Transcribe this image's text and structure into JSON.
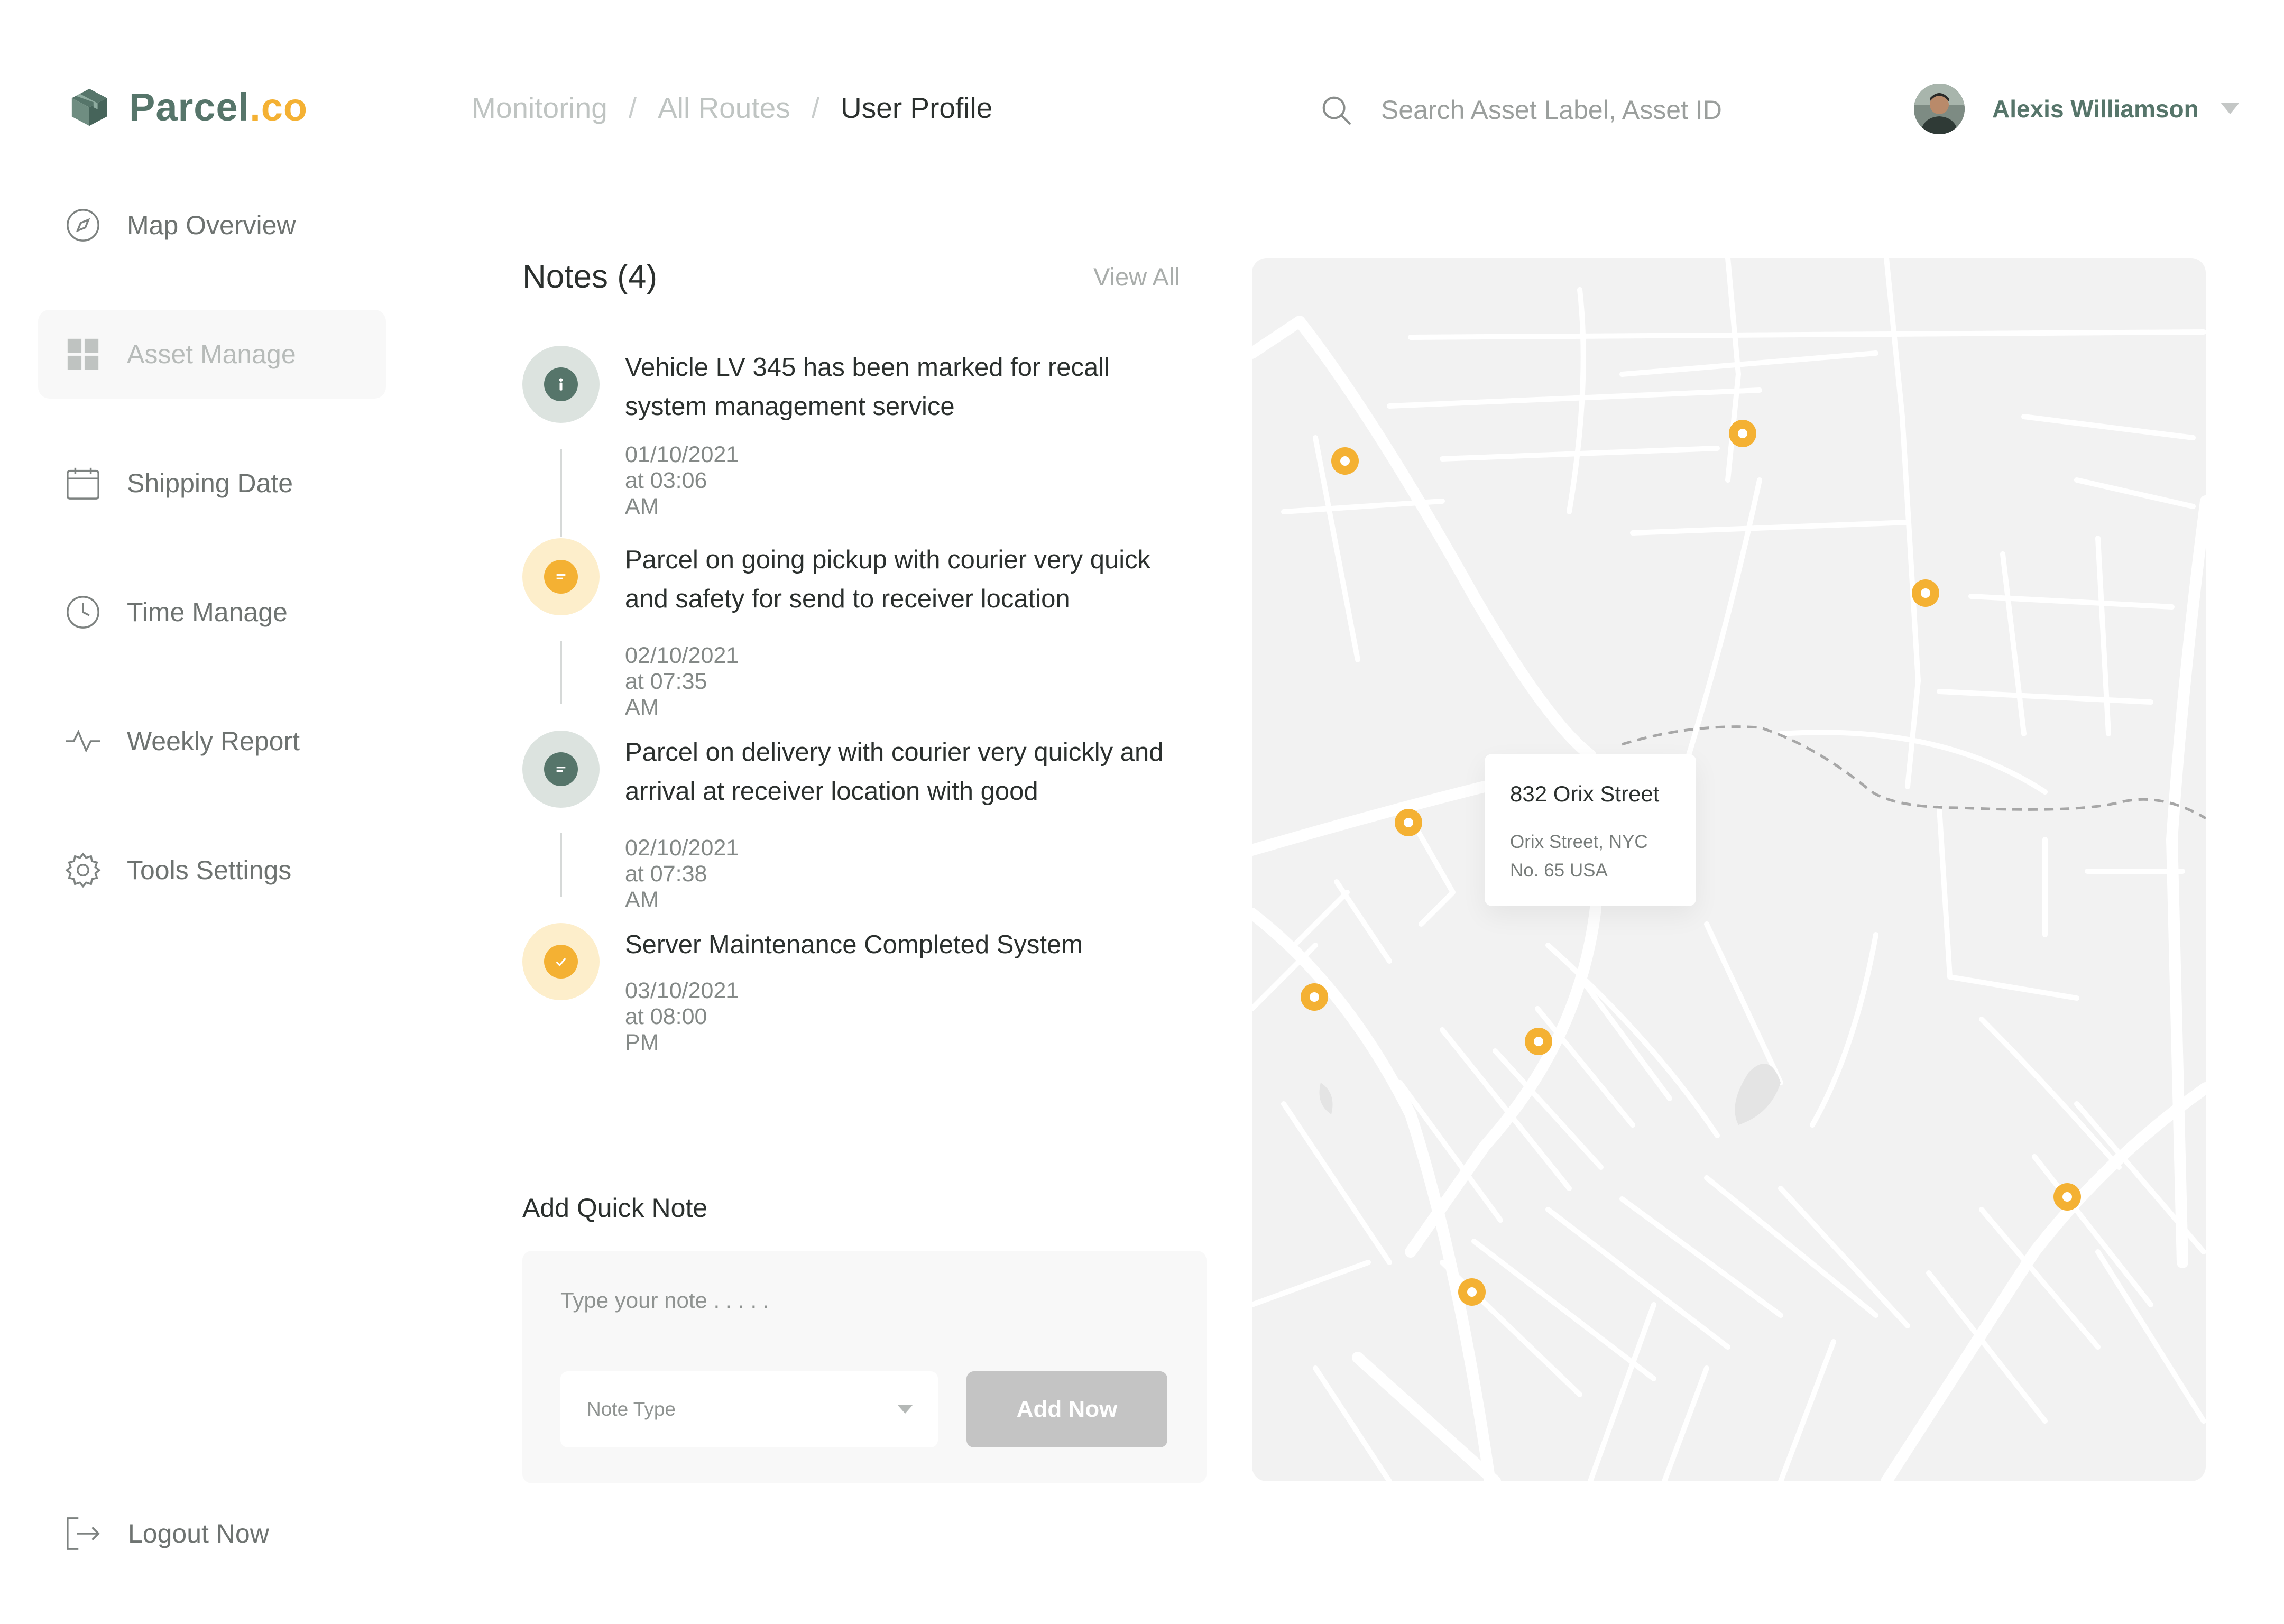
{
  "brand": {
    "name_part1": "Parcel",
    "name_part2": ".co",
    "logo_icon": "parcel-box-icon",
    "colors": {
      "primary": "#56756a",
      "accent": "#f4b133"
    }
  },
  "breadcrumb": [
    {
      "label": "Monitoring"
    },
    {
      "label": "All Routes"
    },
    {
      "label": "User Profile"
    }
  ],
  "breadcrumb_separator": "/",
  "search": {
    "placeholder": "Search Asset Label, Asset ID",
    "icon": "search-icon"
  },
  "user": {
    "name": "Alexis Williamson",
    "menu_icon": "caret-down-icon"
  },
  "sidebar": {
    "items": [
      {
        "label": "Map Overview",
        "icon": "compass-icon",
        "active": false
      },
      {
        "label": "Asset Manage",
        "icon": "grid-icon",
        "active": true
      },
      {
        "label": "Shipping Date",
        "icon": "calendar-icon",
        "active": false
      },
      {
        "label": "Time Manage",
        "icon": "clock-icon",
        "active": false
      },
      {
        "label": "Weekly Report",
        "icon": "activity-icon",
        "active": false
      },
      {
        "label": "Tools Settings",
        "icon": "gear-icon",
        "active": false
      }
    ],
    "logout": {
      "label": "Logout Now",
      "icon": "logout-icon"
    }
  },
  "notes": {
    "title": "Notes (4)",
    "view_all": "View All",
    "items": [
      {
        "text": "Vehicle LV 345 has been marked for recall system management service",
        "time": "01/10/2021 at 03:06 AM",
        "icon": "info-icon",
        "color": "#56756a",
        "bg": "#dce3df"
      },
      {
        "text": "Parcel on going pickup with courier very quick and safety for send to receiver location",
        "time": "02/10/2021 at 07:35 AM",
        "icon": "message-icon",
        "color": "#f4b133",
        "bg": "#fdeecb"
      },
      {
        "text": "Parcel on delivery with courier very quickly and arrival at receiver location with good",
        "time": "02/10/2021 at 07:38 AM",
        "icon": "message-icon",
        "color": "#56756a",
        "bg": "#dce3df"
      },
      {
        "text": "Server Maintenance Completed System",
        "time": "03/10/2021 at 08:00 PM",
        "icon": "check-icon",
        "color": "#f4b133",
        "bg": "#fdeecb"
      }
    ]
  },
  "quick_note": {
    "title": "Add Quick Note",
    "placeholder": "Type your note . . . . .",
    "note_type_placeholder": "Note Type",
    "add_button": "Add Now"
  },
  "map": {
    "card": {
      "title": "832 Orix Street",
      "line1": "Orix Street, NYC",
      "line2": "No. 65 USA"
    },
    "pin_color": "#f4b133",
    "pin_icon": "location-pin-icon"
  }
}
